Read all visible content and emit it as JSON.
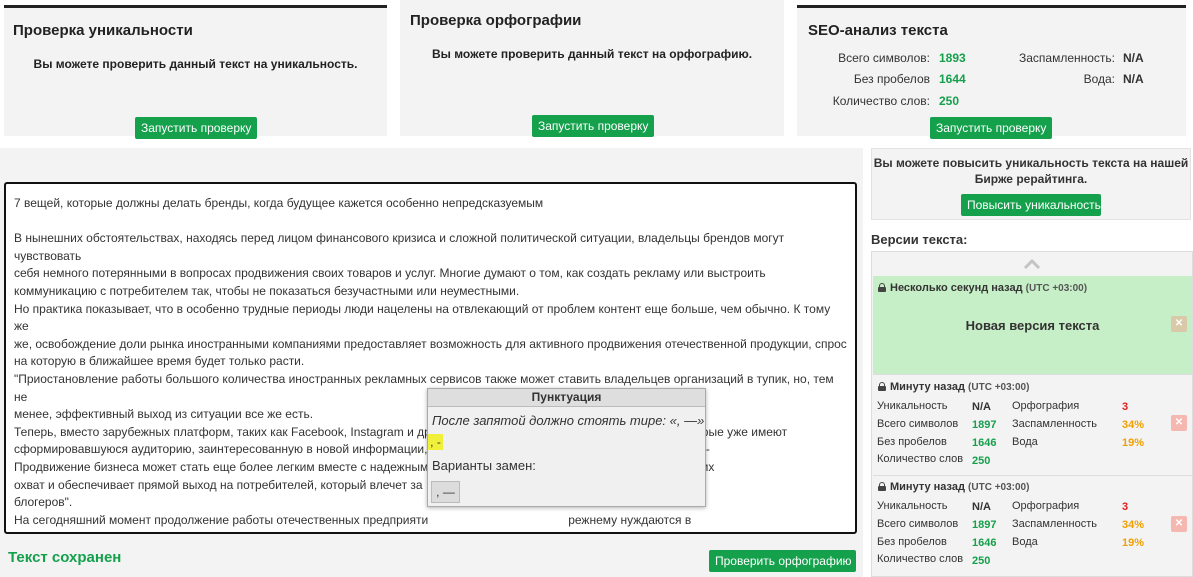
{
  "cards": {
    "uniqueness": {
      "title": "Проверка уникальности",
      "description": "Вы можете проверить данный текст на уникальность.",
      "button": "Запустить проверку"
    },
    "spelling": {
      "title": "Проверка орфографии",
      "description": "Вы можете проверить данный текст на орфографию.",
      "button": "Запустить проверку"
    },
    "seo": {
      "title": "SEO-анализ текста",
      "total_chars_label": "Всего символов:",
      "total_chars": "1893",
      "no_spaces_label": "Без пробелов",
      "no_spaces": "1644",
      "word_count_label": "Количество слов:",
      "word_count": "250",
      "spam_label": "Заспамленность:",
      "spam": "N/A",
      "water_label": "Вода:",
      "water": "N/A",
      "button": "Запустить проверку"
    }
  },
  "editor": {
    "lines": [
      "7 вещей, которые должны делать бренды, когда будущее кажется особенно непредсказуемым",
      "",
      "В нынешних обстоятельствах, находясь перед лицом финансового кризиса и сложной политической ситуации, владельцы брендов могут чувствовать",
      "себя немного потерянными в вопросах продвижения своих товаров и услуг. Многие думают о том, как создать рекламу или выстроить",
      "коммуникацию с потребителем так, чтобы не показаться безучастными или неуместными.",
      "Но практика показывает, что в особенно трудные периоды люди нацелены на отвлекающий от проблем контент еще больше, чем обычно. К тому же",
      "же, освобождение доли рынка иностранными компаниями предоставляет возможность для активного продвижения отечественной продукции, спрос",
      "на которую в ближайшее время будет только расти.",
      "\"Приостановление работы большого количества иностранных рекламных сервисов также может ставить владельцев организаций в тупик, но, тем не",
      "менее, эффективный выход из ситуации все же есть.",
      "Теперь, вместо зарубежных платформ, таких как Facebook, Instagram и др., на помощь приходят традиционные СМИ, которые уже имеют",
      "сформировавшуюся аудиторию, заинтересованную в новой информации,                                                  развитию PRonline. -",
      "Продвижение бизнеса может стать еще более легким вместе с надежным                                          ство имеет всероссийских",
      "охват и обеспечивает прямой выход на потребителей, который влечет за                                        10 000 журналистов и",
      "блогеров\".",
      "На сегодняшний момент продолжение работы отечественных предприяти                                          режнему нуждаются в",
      "различных услугах и новой продукции. И, несмотря на то, что прямо сейч                                        ас, есть несколько",
      "ключевых действий, которые может предпринять бренд, чтобы справитьс                                        отовиться к тому, что",
      "будет дальше."
    ],
    "status": "Текст сохранен",
    "check_button": "Проверить орфографию"
  },
  "popup": {
    "title": "Пунктуация",
    "rule": "После запятой должно стоять тире: «, —»",
    "highlight": ", -",
    "variants_label": "Варианты замен:",
    "option": ", —"
  },
  "sidebar": {
    "upgrade_text": "Вы можете повысить уникальность текста на нашей Бирже рерайтинга.",
    "upgrade_button": "Повысить уникальность",
    "versions_label": "Версии текста:",
    "versions": [
      {
        "time": "Несколько секунд назад",
        "utc": "(UTC +03:00)",
        "title": "Новая версия текста"
      },
      {
        "time": "Минуту назад",
        "utc": "(UTC +03:00)",
        "uniqueness_label": "Уникальность",
        "uniqueness": "N/A",
        "total_label": "Всего символов",
        "total": "1897",
        "no_spaces_label": "Без пробелов",
        "no_spaces": "1646",
        "words_label": "Количество слов",
        "words": "250",
        "spelling_label": "Орфография",
        "spelling": "3",
        "spam_label": "Заспамленность",
        "spam": "34%",
        "water_label": "Вода",
        "water": "19%"
      },
      {
        "time": "Минуту назад",
        "utc": "(UTC +03:00)",
        "uniqueness_label": "Уникальность",
        "uniqueness": "N/A",
        "total_label": "Всего символов",
        "total": "1897",
        "no_spaces_label": "Без пробелов",
        "no_spaces": "1646",
        "words_label": "Количество слов",
        "words": "250",
        "spelling_label": "Орфография",
        "spelling": "3",
        "spam_label": "Заспамленность",
        "spam": "34%",
        "water_label": "Вода",
        "water": "19%"
      }
    ]
  },
  "colors": {
    "accent_green": "#15a04c",
    "error_red": "#e02020",
    "warning_orange": "#f0a000"
  }
}
